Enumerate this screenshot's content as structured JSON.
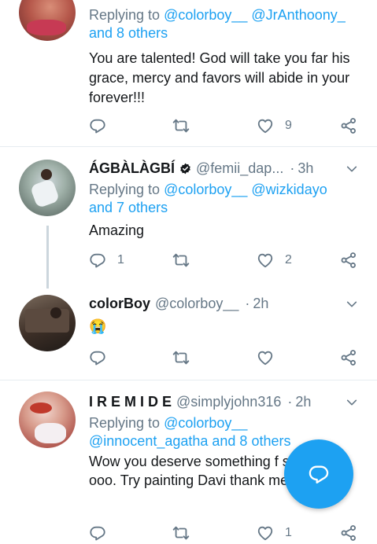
{
  "tweets": [
    {
      "name": "",
      "handle": "",
      "time": "",
      "reply_prefix": "Replying to",
      "reply_links": "@colorboy__ @JrAnthoony_",
      "reply_more": "and 8 others",
      "text": "You are talented! God will take you far his grace, mercy and favors will abide in your forever!!!",
      "reply_count": "",
      "retweet_count": "",
      "like_count": "9"
    },
    {
      "name": "ÁGBÀLÀGBÍ",
      "handle": "@femii_dap...",
      "time": "3h",
      "reply_prefix": "Replying to",
      "reply_links": "@colorboy__ @wizkidayo",
      "reply_more": "and 7 others",
      "text": "Amazing",
      "reply_count": "1",
      "retweet_count": "",
      "like_count": "2"
    },
    {
      "name": "colorBoy",
      "handle": "@colorboy__",
      "time": "2h",
      "text": "😭",
      "reply_count": "",
      "retweet_count": "",
      "like_count": ""
    },
    {
      "name": "I R E M I D E",
      "handle": "@simplyjohn316",
      "time": "2h",
      "reply_prefix": "Replying to",
      "reply_links": "@colorboy__",
      "reply_more": "@innocent_agatha and 8 others",
      "text": "Wow you deserve something f star boi ooo. Try painting Davi thank me later",
      "reply_count": "",
      "retweet_count": "",
      "like_count": "1"
    }
  ],
  "dot": "·",
  "colors": {
    "accent": "#1da1f2",
    "muted": "#657786",
    "divider": "#e6ecf0"
  },
  "icons": [
    "reply-icon",
    "retweet-icon",
    "like-icon",
    "share-icon",
    "chevron-down-icon",
    "verified-badge-icon",
    "compose-icon"
  ]
}
